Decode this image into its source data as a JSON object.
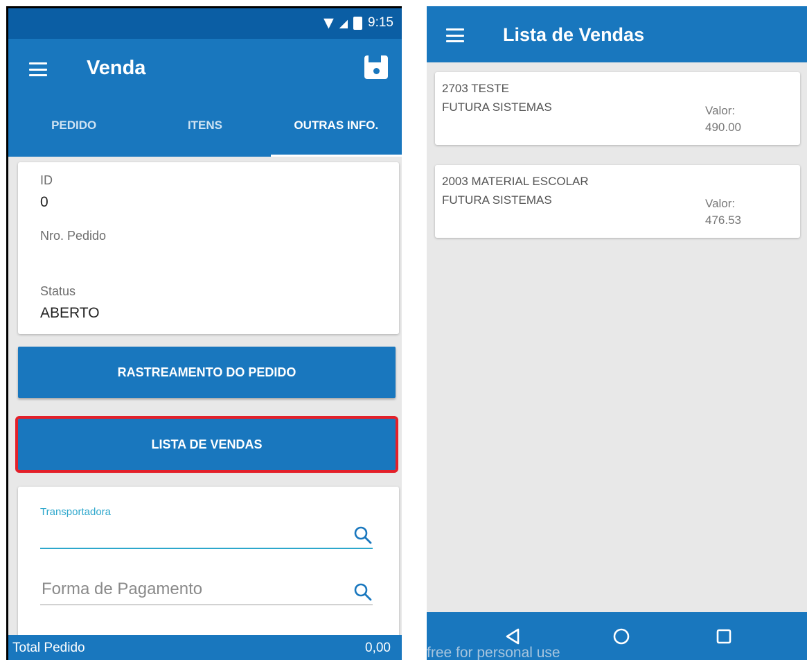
{
  "left": {
    "status_time": "9:15",
    "app_title": "Venda",
    "tabs": [
      {
        "label": "PEDIDO"
      },
      {
        "label": "ITENS"
      },
      {
        "label": "OUTRAS INFO."
      }
    ],
    "info": {
      "id_label": "ID",
      "id_value": "0",
      "nro_label": "Nro. Pedido",
      "nro_value": "",
      "status_label": "Status",
      "status_value": "ABERTO"
    },
    "buttons": {
      "rastreamento": "RASTREAMENTO DO PEDIDO",
      "lista": "LISTA DE VENDAS"
    },
    "form": {
      "transportadora_label": "Transportadora",
      "forma_pagamento_placeholder": "Forma de Pagamento"
    },
    "footer": {
      "total_label": "Total Pedido",
      "total_value": "0,00"
    },
    "colors": {
      "primary": "#1977be",
      "statusbar": "#0b5ea4",
      "highlight": "#e3202a",
      "accent": "#2da7cc"
    }
  },
  "right": {
    "app_title": "Lista de Vendas",
    "sales": [
      {
        "name": "2703 TESTE",
        "client": "FUTURA SISTEMAS",
        "valor_label": "Valor:",
        "valor": "490.00"
      },
      {
        "name": "2003 MATERIAL ESCOLAR",
        "client": "FUTURA SISTEMAS",
        "valor_label": "Valor:",
        "valor": "476.53"
      }
    ],
    "watermark": "free for personal use",
    "nav_icons": [
      "back-icon",
      "home-icon",
      "recents-icon"
    ]
  }
}
